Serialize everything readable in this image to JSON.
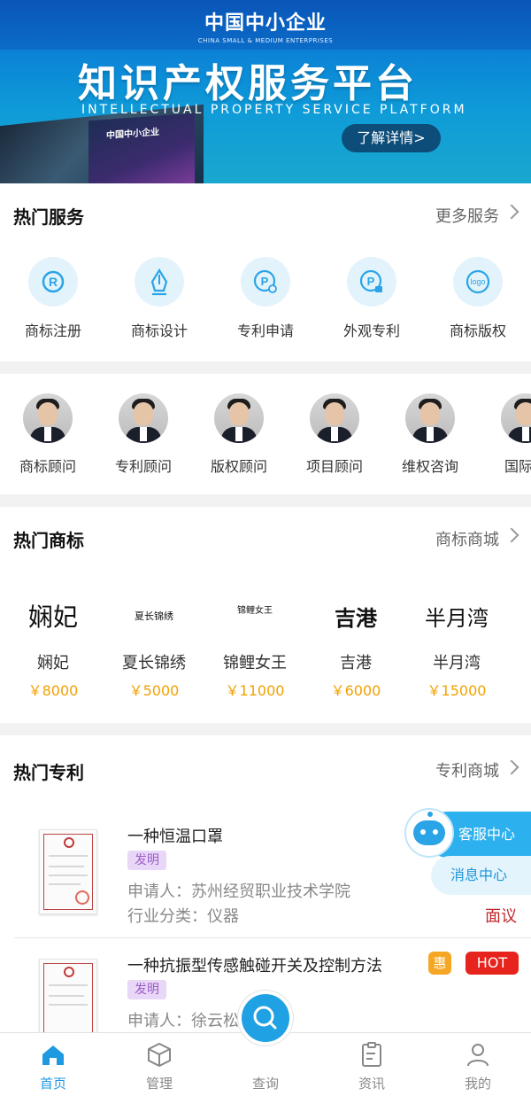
{
  "banner": {
    "org_name": "中国中小企业",
    "org_name_en": "CHINA SMALL & MEDIUM ENTERPRISES",
    "title": "知识产权服务平台",
    "subtitle": "INTELLECTUAL PROPERTY SERVICE PLATFORM",
    "cta": "了解详情>",
    "magazine_text": "中国中小企业"
  },
  "hot_services": {
    "title": "热门服务",
    "more": "更多服务",
    "items": [
      {
        "label": "商标注册",
        "icon": "registered-trademark-icon"
      },
      {
        "label": "商标设计",
        "icon": "pen-nib-icon"
      },
      {
        "label": "专利申请",
        "icon": "patent-bulb-icon"
      },
      {
        "label": "外观专利",
        "icon": "patent-lock-icon"
      },
      {
        "label": "商标版权",
        "icon": "logo-icon"
      }
    ]
  },
  "advisors": {
    "items": [
      {
        "label": "商标顾问"
      },
      {
        "label": "专利顾问"
      },
      {
        "label": "版权顾问"
      },
      {
        "label": "项目顾问"
      },
      {
        "label": "维权咨询"
      },
      {
        "label": "国际商"
      }
    ]
  },
  "hot_trademarks": {
    "title": "热门商标",
    "more": "商标商城",
    "items": [
      {
        "logo_text": "娴妃",
        "name": "娴妃",
        "price": "￥8000"
      },
      {
        "logo_text": "夏长锦绣",
        "name": "夏长锦绣",
        "price": "￥5000"
      },
      {
        "logo_text": "锦鲤女王",
        "name": "锦鲤女王",
        "price": "￥11000"
      },
      {
        "logo_text": "吉港",
        "name": "吉港",
        "price": "￥6000"
      },
      {
        "logo_text": "半月湾",
        "name": "半月湾",
        "price": "￥15000"
      }
    ]
  },
  "hot_patents": {
    "title": "热门专利",
    "more": "专利商城",
    "items": [
      {
        "title": "一种恒温口罩",
        "tag": "发明",
        "applicant": "申请人：苏州经贸职业技术学院",
        "category": "行业分类：仪器",
        "price": "面议"
      },
      {
        "title": "一种抗振型传感触碰开关及控制方法",
        "tag": "发明",
        "applicant": "申请人：徐云松",
        "badge_discount": "惠",
        "badge_hot": "HOT"
      }
    ]
  },
  "floating": {
    "service": "客服中心",
    "messages": "消息中心"
  },
  "tabbar": {
    "items": [
      {
        "label": "首页"
      },
      {
        "label": "管理"
      },
      {
        "label": "查询"
      },
      {
        "label": "资讯"
      },
      {
        "label": "我的"
      }
    ]
  },
  "colors": {
    "accent": "#1f9ae0",
    "price": "#f2a100",
    "negotiable": "#c2272d",
    "hot": "#e6231c",
    "discount": "#f5a623"
  }
}
